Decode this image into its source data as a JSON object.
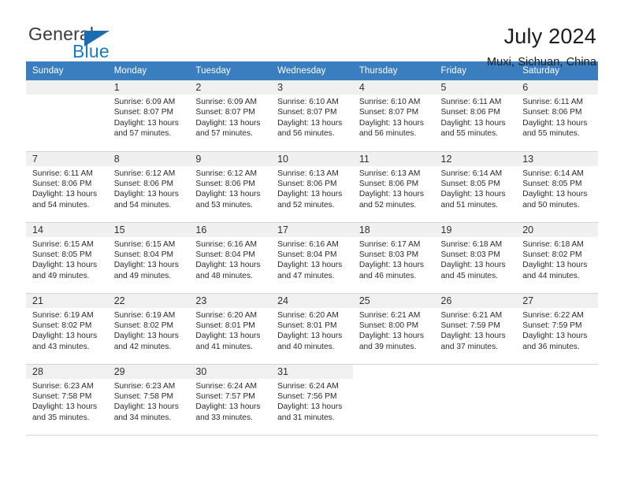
{
  "brand": {
    "name_part1": "General",
    "name_part2": "Blue",
    "logo_icon": "triangle-icon"
  },
  "header": {
    "title": "July 2024",
    "subtitle": "Muxi, Sichuan, China"
  },
  "calendar": {
    "weekdays": [
      "Sunday",
      "Monday",
      "Tuesday",
      "Wednesday",
      "Thursday",
      "Friday",
      "Saturday"
    ],
    "header_bg": "#3a7ebf",
    "header_text": "#ffffff",
    "daynum_band_bg": "#f0f0f0",
    "weeks": [
      [
        {
          "day": "",
          "info": ""
        },
        {
          "day": "1",
          "info": "Sunrise: 6:09 AM\nSunset: 8:07 PM\nDaylight: 13 hours\nand 57 minutes."
        },
        {
          "day": "2",
          "info": "Sunrise: 6:09 AM\nSunset: 8:07 PM\nDaylight: 13 hours\nand 57 minutes."
        },
        {
          "day": "3",
          "info": "Sunrise: 6:10 AM\nSunset: 8:07 PM\nDaylight: 13 hours\nand 56 minutes."
        },
        {
          "day": "4",
          "info": "Sunrise: 6:10 AM\nSunset: 8:07 PM\nDaylight: 13 hours\nand 56 minutes."
        },
        {
          "day": "5",
          "info": "Sunrise: 6:11 AM\nSunset: 8:06 PM\nDaylight: 13 hours\nand 55 minutes."
        },
        {
          "day": "6",
          "info": "Sunrise: 6:11 AM\nSunset: 8:06 PM\nDaylight: 13 hours\nand 55 minutes."
        }
      ],
      [
        {
          "day": "7",
          "info": "Sunrise: 6:11 AM\nSunset: 8:06 PM\nDaylight: 13 hours\nand 54 minutes."
        },
        {
          "day": "8",
          "info": "Sunrise: 6:12 AM\nSunset: 8:06 PM\nDaylight: 13 hours\nand 54 minutes."
        },
        {
          "day": "9",
          "info": "Sunrise: 6:12 AM\nSunset: 8:06 PM\nDaylight: 13 hours\nand 53 minutes."
        },
        {
          "day": "10",
          "info": "Sunrise: 6:13 AM\nSunset: 8:06 PM\nDaylight: 13 hours\nand 52 minutes."
        },
        {
          "day": "11",
          "info": "Sunrise: 6:13 AM\nSunset: 8:06 PM\nDaylight: 13 hours\nand 52 minutes."
        },
        {
          "day": "12",
          "info": "Sunrise: 6:14 AM\nSunset: 8:05 PM\nDaylight: 13 hours\nand 51 minutes."
        },
        {
          "day": "13",
          "info": "Sunrise: 6:14 AM\nSunset: 8:05 PM\nDaylight: 13 hours\nand 50 minutes."
        }
      ],
      [
        {
          "day": "14",
          "info": "Sunrise: 6:15 AM\nSunset: 8:05 PM\nDaylight: 13 hours\nand 49 minutes."
        },
        {
          "day": "15",
          "info": "Sunrise: 6:15 AM\nSunset: 8:04 PM\nDaylight: 13 hours\nand 49 minutes."
        },
        {
          "day": "16",
          "info": "Sunrise: 6:16 AM\nSunset: 8:04 PM\nDaylight: 13 hours\nand 48 minutes."
        },
        {
          "day": "17",
          "info": "Sunrise: 6:16 AM\nSunset: 8:04 PM\nDaylight: 13 hours\nand 47 minutes."
        },
        {
          "day": "18",
          "info": "Sunrise: 6:17 AM\nSunset: 8:03 PM\nDaylight: 13 hours\nand 46 minutes."
        },
        {
          "day": "19",
          "info": "Sunrise: 6:18 AM\nSunset: 8:03 PM\nDaylight: 13 hours\nand 45 minutes."
        },
        {
          "day": "20",
          "info": "Sunrise: 6:18 AM\nSunset: 8:02 PM\nDaylight: 13 hours\nand 44 minutes."
        }
      ],
      [
        {
          "day": "21",
          "info": "Sunrise: 6:19 AM\nSunset: 8:02 PM\nDaylight: 13 hours\nand 43 minutes."
        },
        {
          "day": "22",
          "info": "Sunrise: 6:19 AM\nSunset: 8:02 PM\nDaylight: 13 hours\nand 42 minutes."
        },
        {
          "day": "23",
          "info": "Sunrise: 6:20 AM\nSunset: 8:01 PM\nDaylight: 13 hours\nand 41 minutes."
        },
        {
          "day": "24",
          "info": "Sunrise: 6:20 AM\nSunset: 8:01 PM\nDaylight: 13 hours\nand 40 minutes."
        },
        {
          "day": "25",
          "info": "Sunrise: 6:21 AM\nSunset: 8:00 PM\nDaylight: 13 hours\nand 39 minutes."
        },
        {
          "day": "26",
          "info": "Sunrise: 6:21 AM\nSunset: 7:59 PM\nDaylight: 13 hours\nand 37 minutes."
        },
        {
          "day": "27",
          "info": "Sunrise: 6:22 AM\nSunset: 7:59 PM\nDaylight: 13 hours\nand 36 minutes."
        }
      ],
      [
        {
          "day": "28",
          "info": "Sunrise: 6:23 AM\nSunset: 7:58 PM\nDaylight: 13 hours\nand 35 minutes."
        },
        {
          "day": "29",
          "info": "Sunrise: 6:23 AM\nSunset: 7:58 PM\nDaylight: 13 hours\nand 34 minutes."
        },
        {
          "day": "30",
          "info": "Sunrise: 6:24 AM\nSunset: 7:57 PM\nDaylight: 13 hours\nand 33 minutes."
        },
        {
          "day": "31",
          "info": "Sunrise: 6:24 AM\nSunset: 7:56 PM\nDaylight: 13 hours\nand 31 minutes."
        },
        {
          "day": "",
          "info": ""
        },
        {
          "day": "",
          "info": ""
        },
        {
          "day": "",
          "info": ""
        }
      ]
    ]
  }
}
